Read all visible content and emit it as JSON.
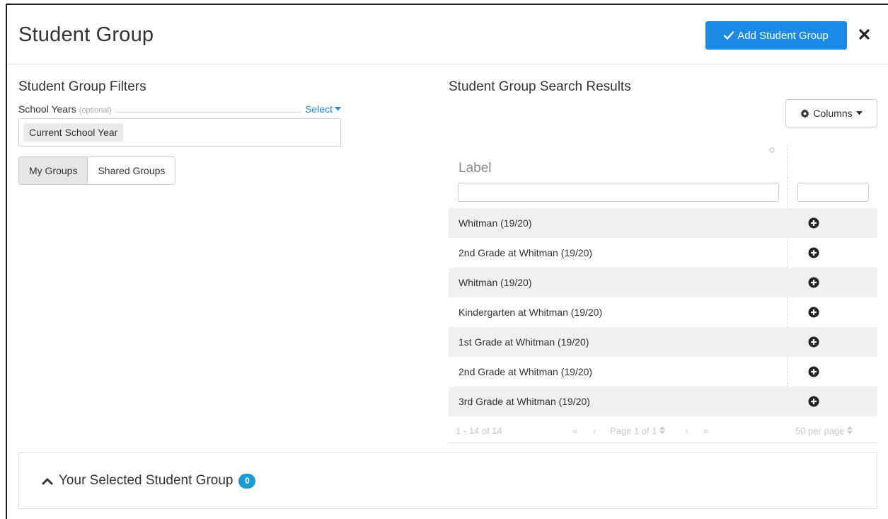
{
  "header": {
    "title": "Student Group",
    "add_label": "Add Student Group"
  },
  "filters": {
    "title": "Student Group Filters",
    "school_years_label": "School Years",
    "optional_label": "(optional)",
    "select_label": "Select",
    "chip": "Current School Year",
    "tabs": [
      {
        "label": "My Groups",
        "active": true
      },
      {
        "label": "Shared Groups",
        "active": false
      }
    ]
  },
  "results": {
    "title": "Student Group Search Results",
    "columns_label": "Columns",
    "label_header": "Label",
    "rows": [
      {
        "label": "Whitman (19/20)"
      },
      {
        "label": "2nd Grade at Whitman (19/20)"
      },
      {
        "label": "Whitman (19/20)"
      },
      {
        "label": "Kindergarten at Whitman (19/20)"
      },
      {
        "label": "1st Grade at Whitman (19/20)"
      },
      {
        "label": "2nd Grade at Whitman (19/20)"
      },
      {
        "label": "3rd Grade at Whitman (19/20)"
      }
    ],
    "pager": {
      "range": "1 - 14 of 14",
      "first": "«",
      "prev": "‹",
      "page": "Page 1 of 1",
      "next": "›",
      "last": "»",
      "per_page": "50 per page"
    }
  },
  "selected": {
    "title": "Your Selected Student Group",
    "count": "0"
  },
  "colors": {
    "primary": "#1a8ae6",
    "badge": "#1b9bd1",
    "row_stripe": "#f0f0f0"
  },
  "icons": [
    "check-icon",
    "close-icon",
    "caret-down-icon",
    "gear-icon",
    "plus-circle-icon",
    "chevron-up-icon",
    "sort-icon"
  ]
}
